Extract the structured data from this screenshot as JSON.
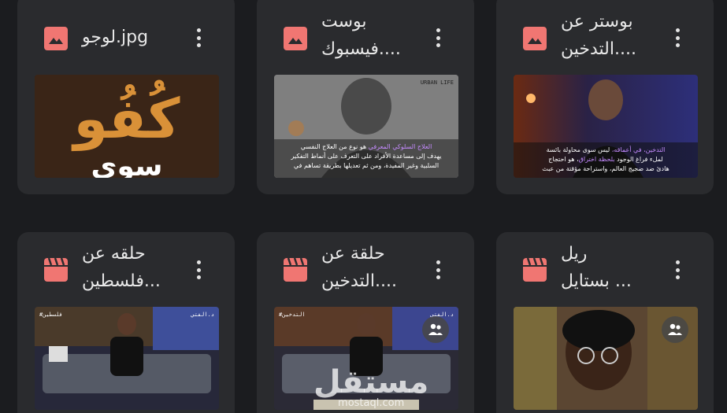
{
  "files": [
    {
      "title": "لوجو.jpg",
      "type": "image",
      "icon": "image-icon",
      "thumb": {
        "logo_text": "كُفُو",
        "logo_sub": "سوى"
      }
    },
    {
      "title": "بوست\nفيسبوك....",
      "type": "image",
      "icon": "image-icon",
      "thumb": {
        "line1_hl": "العلاج السلوكي المعرفي",
        "line1": "هو نوع من العلاج النفسي",
        "line2": "يهدف إلى مساعدة الأفراد على التعرف على أنماط التفكير",
        "line3": "السلبية وغير المفيدة، ومن ثم تعديلها بطريقة تساهم في",
        "corner": "URBAN LIFE"
      }
    },
    {
      "title": "بوستر عن\nالتدخين....",
      "type": "image",
      "icon": "image-icon",
      "thumb": {
        "line1_hl": "التدخين، في أعماقه،",
        "line1": "ليس سوى محاولة بائسة",
        "line2_a": "لملء فراغ الوجود",
        "line2_hl": "بلحظة اختراق",
        "line2_b": "، هو احتجاج",
        "line3": "هادئ ضد ضجيج العالم، واستراحة مؤقتة من عبث"
      }
    },
    {
      "title": "حلقه عن\nفلسطين...",
      "type": "video",
      "icon": "clapperboard-icon",
      "thumb": {
        "tag_left": "#فلسطين",
        "tag_right": "د.الفتي"
      }
    },
    {
      "title": "حلقة عن\nالتدخين....",
      "type": "video",
      "icon": "clapperboard-icon",
      "thumb": {
        "tag_left": "#التدخين",
        "tag_right": "د.الفتي"
      }
    },
    {
      "title": "ريل\nبستايل ...",
      "type": "video",
      "icon": "clapperboard-icon",
      "thumb": {}
    }
  ],
  "watermark": {
    "arabic": "مستقل",
    "latin": "mostaql.com"
  },
  "colors": {
    "background": "#1b1c1f",
    "card": "#2a2b2e",
    "icon": "#f07672",
    "text": "#e8e8e8"
  }
}
